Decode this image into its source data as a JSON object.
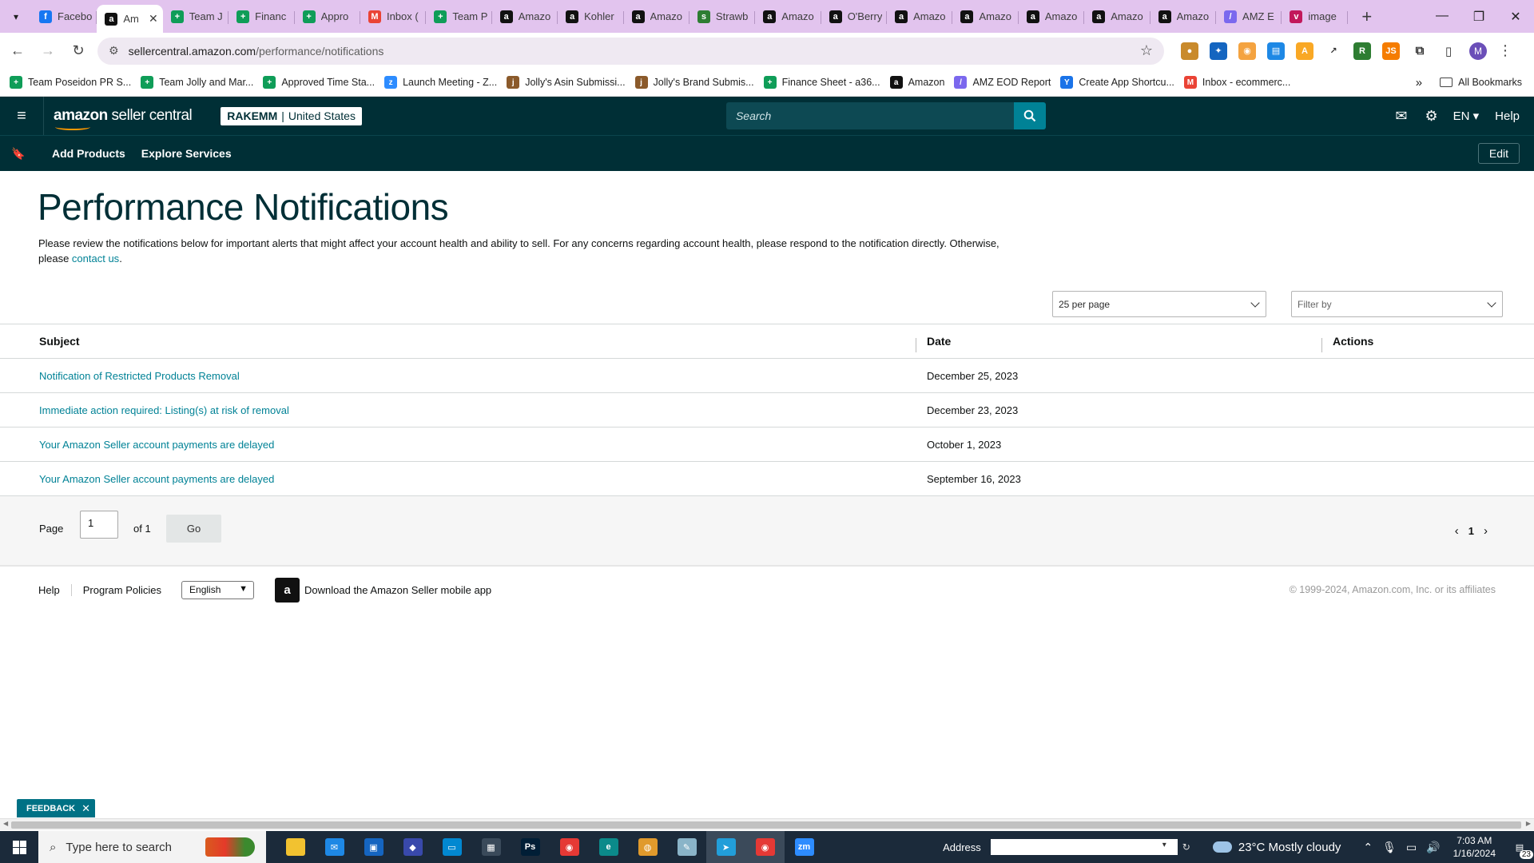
{
  "browser": {
    "tabs": [
      {
        "title": "Facebo",
        "icon": "facebook-icon",
        "color": "#1877f2",
        "glyph": "f"
      },
      {
        "title": "Am",
        "icon": "amazon-icon",
        "color": "#111111",
        "glyph": "a",
        "active": true
      },
      {
        "title": "Team J",
        "icon": "sheets-icon",
        "color": "#0f9d58",
        "glyph": "+"
      },
      {
        "title": "Financ",
        "icon": "sheets-icon",
        "color": "#0f9d58",
        "glyph": "+"
      },
      {
        "title": "Appro",
        "icon": "sheets-icon",
        "color": "#0f9d58",
        "glyph": "+"
      },
      {
        "title": "Inbox (",
        "icon": "gmail-icon",
        "color": "#ea4335",
        "glyph": "M"
      },
      {
        "title": "Team P",
        "icon": "sheets-icon",
        "color": "#0f9d58",
        "glyph": "+"
      },
      {
        "title": "Amazo",
        "icon": "amazon-icon",
        "color": "#111111",
        "glyph": "a"
      },
      {
        "title": "Kohler",
        "icon": "amazon-icon",
        "color": "#111111",
        "glyph": "a"
      },
      {
        "title": "Amazo",
        "icon": "amazon-icon",
        "color": "#111111",
        "glyph": "a"
      },
      {
        "title": "Strawb",
        "icon": "strawberry-icon",
        "color": "#2e7d32",
        "glyph": "s"
      },
      {
        "title": "Amazo",
        "icon": "amazon-icon",
        "color": "#111111",
        "glyph": "a"
      },
      {
        "title": "O'Berry",
        "icon": "amazon-icon",
        "color": "#111111",
        "glyph": "a"
      },
      {
        "title": "Amazo",
        "icon": "amazon-icon",
        "color": "#111111",
        "glyph": "a"
      },
      {
        "title": "Amazo",
        "icon": "amazon-icon",
        "color": "#111111",
        "glyph": "a"
      },
      {
        "title": "Amazo",
        "icon": "amazon-icon",
        "color": "#111111",
        "glyph": "a"
      },
      {
        "title": "Amazo",
        "icon": "amazon-icon",
        "color": "#111111",
        "glyph": "a"
      },
      {
        "title": "Amazo",
        "icon": "amazon-icon",
        "color": "#111111",
        "glyph": "a"
      },
      {
        "title": "AMZ E",
        "icon": "clickup-icon",
        "color": "#7b68ee",
        "glyph": "/"
      },
      {
        "title": "image",
        "icon": "image-icon",
        "color": "#c2185b",
        "glyph": "v"
      }
    ],
    "url_host": "sellercentral.amazon.com",
    "url_path": "/performance/notifications",
    "profile_initial": "M",
    "bookmarks": [
      {
        "label": "Team Poseidon PR S...",
        "icon": "sheets-icon",
        "color": "#0f9d58",
        "glyph": "+"
      },
      {
        "label": "Team Jolly and Mar...",
        "icon": "sheets-icon",
        "color": "#0f9d58",
        "glyph": "+"
      },
      {
        "label": "Approved Time Sta...",
        "icon": "sheets-icon",
        "color": "#0f9d58",
        "glyph": "+"
      },
      {
        "label": "Launch Meeting - Z...",
        "icon": "zoom-icon",
        "color": "#2d8cff",
        "glyph": "z"
      },
      {
        "label": "Jolly's Asin Submissi...",
        "icon": "form-icon",
        "color": "#8b5a2b",
        "glyph": "j"
      },
      {
        "label": "Jolly's Brand Submis...",
        "icon": "form-icon",
        "color": "#8b5a2b",
        "glyph": "j"
      },
      {
        "label": "Finance Sheet - a36...",
        "icon": "sheets-icon",
        "color": "#0f9d58",
        "glyph": "+"
      },
      {
        "label": "Amazon",
        "icon": "amazon-icon",
        "color": "#111111",
        "glyph": "a"
      },
      {
        "label": "AMZ EOD Report",
        "icon": "clickup-icon",
        "color": "#7b68ee",
        "glyph": "/"
      },
      {
        "label": "Create App Shortcu...",
        "icon": "shortcut-icon",
        "color": "#1a73e8",
        "glyph": "Y"
      },
      {
        "label": "Inbox - ecommerc...",
        "icon": "gmail-icon",
        "color": "#ea4335",
        "glyph": "M"
      }
    ],
    "all_bookmarks": "All Bookmarks"
  },
  "header": {
    "logo_bold": "amazon",
    "logo_light": " seller central",
    "account_name": "RAKEMM",
    "account_sep": "|",
    "account_region": "United States",
    "search_placeholder": "Search",
    "lang": "EN",
    "help": "Help"
  },
  "subnav": {
    "links": [
      "Add Products",
      "Explore Services"
    ],
    "edit": "Edit"
  },
  "page": {
    "title": "Performance Notifications",
    "intro": "Please review the notifications below for important alerts that might affect your account health and ability to sell. For any concerns regarding account health, please respond to the notification directly. Otherwise, please ",
    "intro_link": "contact us",
    "intro_end": ".",
    "per_page": "25 per page",
    "filter_by": "Filter by"
  },
  "table": {
    "columns": [
      "Subject",
      "Date",
      "Actions"
    ],
    "rows": [
      {
        "subject": "Notification of Restricted Products Removal",
        "date": "December 25, 2023"
      },
      {
        "subject": "Immediate action required: Listing(s) at risk of removal",
        "date": "December 23, 2023"
      },
      {
        "subject": "Your Amazon Seller account payments are delayed",
        "date": "October 1, 2023"
      },
      {
        "subject": "Your Amazon Seller account payments are delayed",
        "date": "September 16, 2023"
      }
    ]
  },
  "pager": {
    "page_label": "Page",
    "page_value": "1",
    "of_label": "of 1",
    "go": "Go",
    "current": "1"
  },
  "footer": {
    "help": "Help",
    "policies": "Program Policies",
    "language": "English",
    "app_text": "Download the Amazon Seller mobile app",
    "copyright": "© 1999-2024, Amazon.com, Inc. or its affiliates"
  },
  "feedback": "FEEDBACK",
  "taskbar": {
    "search_placeholder": "Type here to search",
    "address_label": "Address",
    "weather": "23°C  Mostly cloudy",
    "time": "7:03 AM",
    "date": "1/16/2024",
    "notifications": "23",
    "apps": [
      {
        "name": "file-explorer-icon",
        "color": "#f2c230",
        "glyph": ""
      },
      {
        "name": "mail-icon",
        "color": "#1e88e5",
        "glyph": "✉"
      },
      {
        "name": "store-icon",
        "color": "#1565c0",
        "glyph": "▣"
      },
      {
        "name": "app-icon",
        "color": "#3949ab",
        "glyph": "◆"
      },
      {
        "name": "remote-icon",
        "color": "#0288d1",
        "glyph": "▭"
      },
      {
        "name": "calculator-icon",
        "color": "#3a4a5a",
        "glyph": "▦"
      },
      {
        "name": "photoshop-icon",
        "color": "#001e36",
        "glyph": "Ps"
      },
      {
        "name": "chrome-icon",
        "color": "#e53935",
        "glyph": "◉"
      },
      {
        "name": "edge-icon",
        "color": "#0b8a8a",
        "glyph": "e"
      },
      {
        "name": "app-icon",
        "color": "#e09a2c",
        "glyph": "◍"
      },
      {
        "name": "notepad-icon",
        "color": "#8ab4c8",
        "glyph": "✎"
      },
      {
        "name": "telegram-icon",
        "color": "#229ed9",
        "glyph": "➤"
      },
      {
        "name": "chrome-profile-icon",
        "color": "#e53935",
        "glyph": "◉"
      },
      {
        "name": "zoom-icon",
        "color": "#2d8cff",
        "glyph": "zm"
      }
    ]
  }
}
